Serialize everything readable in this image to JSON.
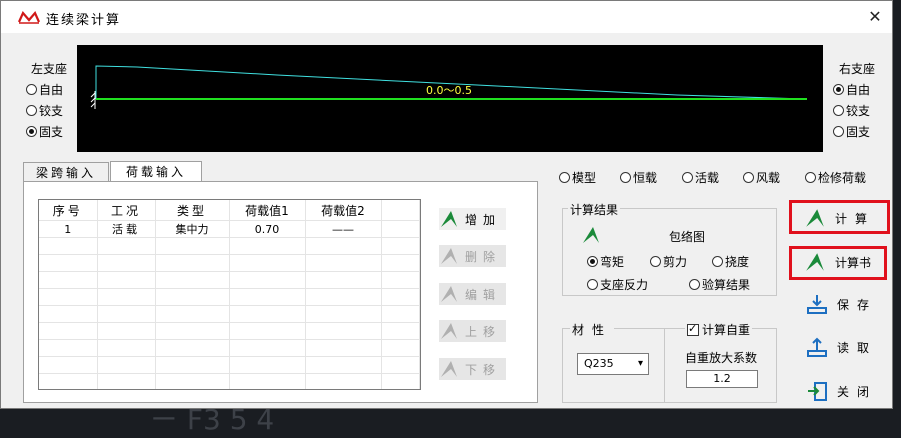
{
  "window": {
    "title": "连续梁计算"
  },
  "left_support": {
    "label": "左支座",
    "options": [
      "自由",
      "铰支",
      "固支"
    ],
    "selected": 2
  },
  "right_support": {
    "label": "右支座",
    "options": [
      "自由",
      "铰支",
      "固支"
    ],
    "selected": 0
  },
  "canvas": {
    "range_label": "0.0～0.5",
    "line_colors": {
      "beam": "#20e020",
      "moment": "#40e0e0"
    }
  },
  "tabs": [
    {
      "label": "梁跨输入"
    },
    {
      "label": "荷载输入"
    }
  ],
  "load_table": {
    "columns": [
      "序号",
      "工况",
      "类型",
      "荷载值1",
      "荷载值2"
    ],
    "rows": [
      [
        "1",
        "活载",
        "集中力",
        "0.70",
        "——"
      ]
    ]
  },
  "side_buttons": {
    "add": "增加",
    "delete": "删除",
    "edit": "编辑",
    "up": "上移",
    "down": "下移"
  },
  "view_options": {
    "items": [
      "模型",
      "恒载",
      "活载",
      "风载",
      "检修荷载"
    ],
    "selected": -1
  },
  "results": {
    "title": "计算结果",
    "envelope_label": "包络图",
    "options": [
      "弯矩",
      "剪力",
      "挠度",
      "支座反力",
      "验算结果"
    ],
    "selected": 0
  },
  "material": {
    "title": "材性",
    "value": "Q235"
  },
  "self_weight": {
    "checkbox_label": "计算自重",
    "checked": true,
    "factor_label": "自重放大系数",
    "factor_value": "1.2"
  },
  "actions": {
    "calc": "计算",
    "report": "计算书",
    "save": "保存",
    "read": "读取",
    "close": "关闭"
  },
  "colors": {
    "highlight": "#e0101c",
    "icon_green": "#1b8a3a",
    "icon_blue": "#1d6fc1"
  }
}
